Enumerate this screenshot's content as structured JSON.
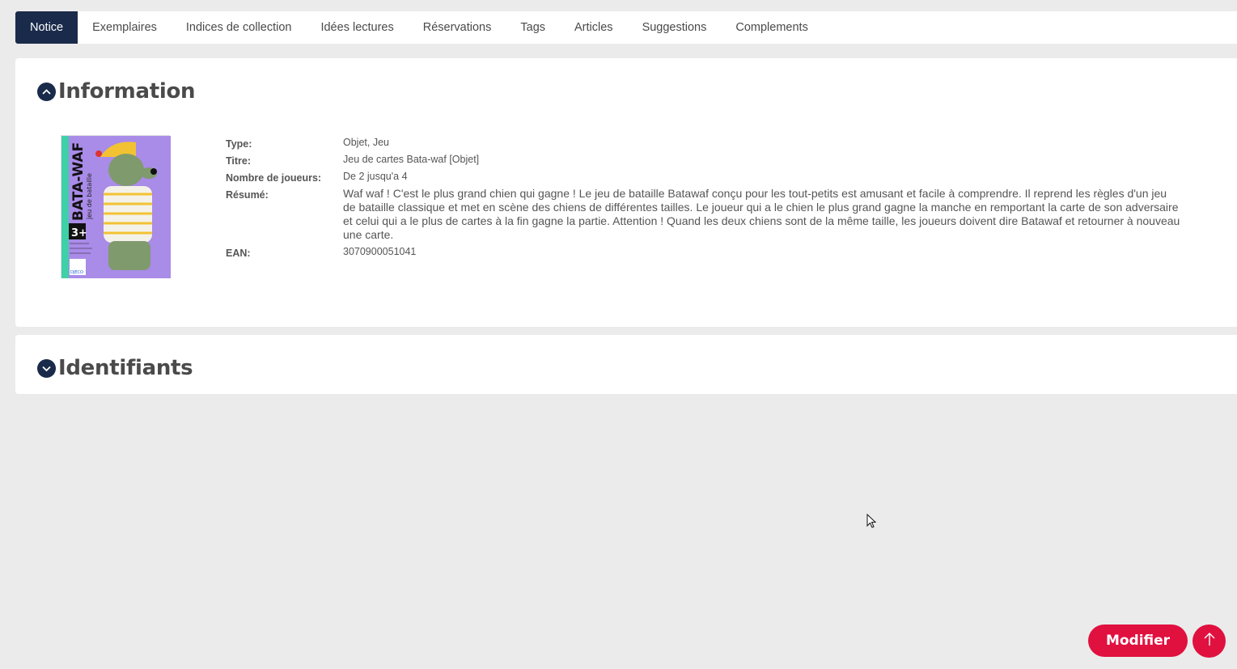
{
  "tabs": [
    {
      "label": "Notice",
      "active": true
    },
    {
      "label": "Exemplaires"
    },
    {
      "label": "Indices de collection"
    },
    {
      "label": "Idées lectures"
    },
    {
      "label": "Réservations"
    },
    {
      "label": "Tags"
    },
    {
      "label": "Articles"
    },
    {
      "label": "Suggestions"
    },
    {
      "label": "Complements"
    }
  ],
  "information": {
    "title": "Information",
    "toggle_icon": "chevron-up-icon",
    "cover": {
      "title_text": "BATA-WAF",
      "subtitle_text": "jeu de bataille",
      "age_text": "3+",
      "brand_text": "DJECO"
    },
    "fields": [
      {
        "label": "Type:",
        "value": "Objet, Jeu"
      },
      {
        "label": "Titre:",
        "value": "Jeu de cartes Bata-waf [Objet]"
      },
      {
        "label": "Nombre de joueurs:",
        "value": "De 2 jusqu'a 4"
      },
      {
        "label": "Résumé:",
        "value": "Waf waf ! C'est le plus grand chien qui gagne ! Le jeu de bataille Batawaf conçu pour les tout-petits est amusant et facile à comprendre. Il reprend les règles d'un jeu de bataille classique et met en scène des chiens de différentes tailles. Le joueur qui a le chien le plus grand gagne la manche en remportant la carte de son adversaire et celui qui a le plus de cartes à la fin gagne la partie. Attention ! Quand les deux chiens sont de la même taille, les joueurs doivent dire Batawaf et retourner à nouveau une carte."
      },
      {
        "label": "EAN:",
        "value": "3070900051041"
      }
    ]
  },
  "identifiants": {
    "title": "Identifiants",
    "toggle_icon": "chevron-down-icon"
  },
  "actions": {
    "modifier_label": "Modifier",
    "scroll_top_icon": "arrow-up-icon"
  },
  "colors": {
    "navy": "#1a2a4a",
    "accent": "#e0103f",
    "background": "#ebebeb"
  }
}
